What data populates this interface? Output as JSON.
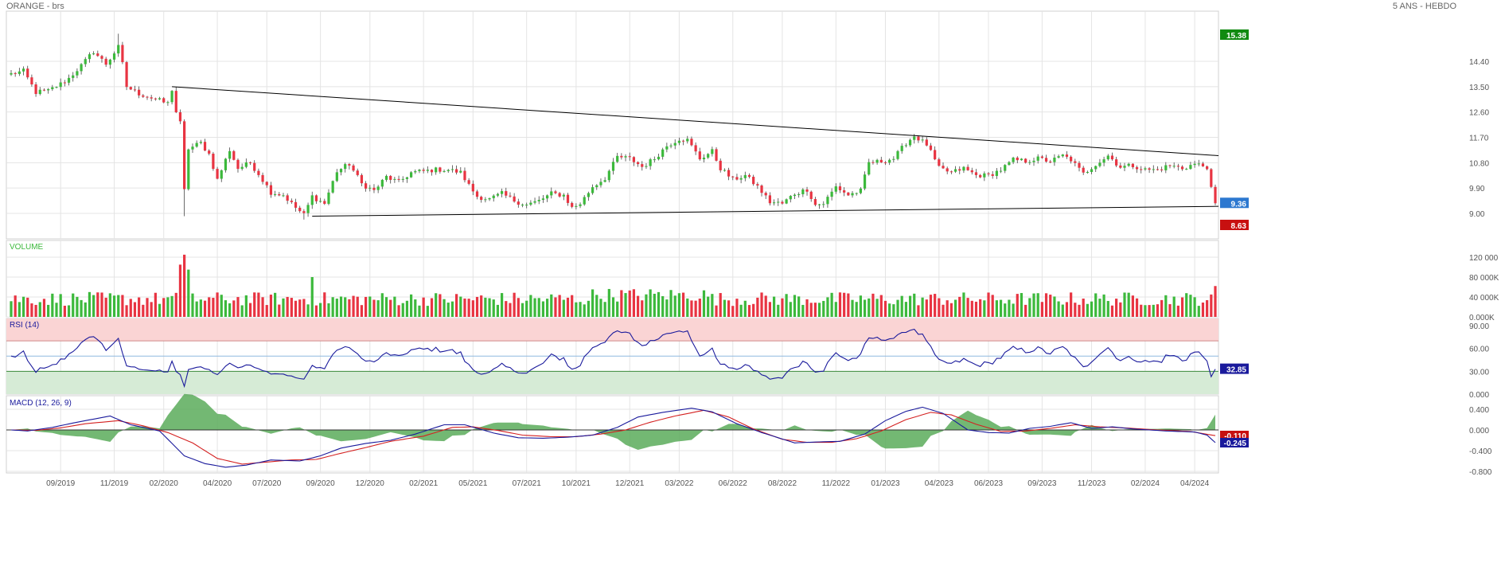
{
  "header": {
    "title": "ORANGE - brs",
    "period": "5 ANS - HEBDO"
  },
  "colors": {
    "up": "#3cb93c",
    "down": "#e83442",
    "grid": "#e4e4e4",
    "axis_text": "#555555",
    "trendline": "#000000",
    "rsi_line": "#1a1a9c",
    "rsi_overbought_fill": "#fad4d4",
    "rsi_oversold_fill": "#d6ebd6",
    "macd_line": "#1a1a9c",
    "signal_line": "#d42020",
    "histogram": "#5aab5a",
    "badge_high": "#118a11",
    "badge_low": "#c81010",
    "badge_last": "#2c78d0",
    "badge_rsi": "#1a1a9c",
    "badge_signal": "#c81010",
    "badge_macd": "#1a1a9c"
  },
  "chart_data": [
    {
      "type": "candlestick",
      "name": "price",
      "y_ticks": [
        "14.40",
        "13.50",
        "12.60",
        "11.70",
        "10.80",
        "9.90",
        "9.00"
      ],
      "y_range": [
        8.63,
        15.38
      ],
      "x_tick_labels": [
        "09/2019",
        "11/2019",
        "02/2020",
        "04/2020",
        "07/2020",
        "09/2020",
        "12/2020",
        "02/2021",
        "05/2021",
        "07/2021",
        "10/2021",
        "12/2021",
        "03/2022",
        "06/2022",
        "08/2022",
        "11/2022",
        "01/2023",
        "04/2023",
        "06/2023",
        "09/2023",
        "11/2023",
        "02/2024",
        "04/2024"
      ],
      "close_anchors": [
        [
          0,
          13.95
        ],
        [
          3,
          14.05
        ],
        [
          6,
          13.3
        ],
        [
          9,
          13.35
        ],
        [
          12,
          13.6
        ],
        [
          14,
          13.8
        ],
        [
          17,
          14.25
        ],
        [
          20,
          14.75
        ],
        [
          23,
          14.3
        ],
        [
          26,
          14.9
        ],
        [
          27,
          14.3
        ],
        [
          28,
          13.5
        ],
        [
          31,
          13.25
        ],
        [
          35,
          13.05
        ],
        [
          38,
          12.9
        ],
        [
          39,
          13.4
        ],
        [
          40,
          12.6
        ],
        [
          41,
          12.2
        ],
        [
          42,
          9.8
        ],
        [
          43,
          11.3
        ],
        [
          46,
          11.5
        ],
        [
          48,
          11.1
        ],
        [
          50,
          10.2
        ],
        [
          53,
          11.25
        ],
        [
          55,
          10.6
        ],
        [
          58,
          10.8
        ],
        [
          60,
          10.4
        ],
        [
          63,
          9.75
        ],
        [
          66,
          9.65
        ],
        [
          69,
          9.2
        ],
        [
          71,
          8.95
        ],
        [
          73,
          9.6
        ],
        [
          76,
          9.35
        ],
        [
          79,
          10.5
        ],
        [
          82,
          10.75
        ],
        [
          85,
          10.05
        ],
        [
          88,
          9.8
        ],
        [
          91,
          10.3
        ],
        [
          94,
          10.1
        ],
        [
          97,
          10.45
        ],
        [
          100,
          10.5
        ],
        [
          103,
          10.55
        ],
        [
          106,
          10.55
        ],
        [
          109,
          10.45
        ],
        [
          111,
          10.0
        ],
        [
          113,
          9.6
        ],
        [
          116,
          9.5
        ],
        [
          119,
          9.7
        ],
        [
          122,
          9.45
        ],
        [
          125,
          9.3
        ],
        [
          128,
          9.45
        ],
        [
          131,
          9.7
        ],
        [
          134,
          9.65
        ],
        [
          136,
          9.2
        ],
        [
          138,
          9.35
        ],
        [
          141,
          9.95
        ],
        [
          144,
          10.25
        ],
        [
          147,
          11.0
        ],
        [
          150,
          10.95
        ],
        [
          153,
          10.65
        ],
        [
          156,
          10.95
        ],
        [
          159,
          11.4
        ],
        [
          162,
          11.65
        ],
        [
          164,
          11.6
        ],
        [
          167,
          10.95
        ],
        [
          170,
          11.2
        ],
        [
          172,
          10.6
        ],
        [
          175,
          10.2
        ],
        [
          178,
          10.35
        ],
        [
          181,
          9.95
        ],
        [
          184,
          9.4
        ],
        [
          187,
          9.35
        ],
        [
          190,
          9.7
        ],
        [
          193,
          9.85
        ],
        [
          195,
          9.3
        ],
        [
          197,
          9.35
        ],
        [
          200,
          9.95
        ],
        [
          203,
          9.65
        ],
        [
          206,
          9.8
        ],
        [
          208,
          10.8
        ],
        [
          211,
          10.85
        ],
        [
          214,
          10.95
        ],
        [
          217,
          11.5
        ],
        [
          219,
          11.75
        ],
        [
          222,
          11.45
        ],
        [
          225,
          10.6
        ],
        [
          228,
          10.45
        ],
        [
          231,
          10.6
        ],
        [
          234,
          10.35
        ],
        [
          237,
          10.35
        ],
        [
          240,
          10.55
        ],
        [
          243,
          10.9
        ],
        [
          246,
          10.85
        ],
        [
          249,
          10.95
        ],
        [
          252,
          10.85
        ],
        [
          255,
          11.05
        ],
        [
          257,
          10.9
        ],
        [
          260,
          10.4
        ],
        [
          263,
          10.75
        ],
        [
          266,
          11.05
        ],
        [
          269,
          10.65
        ],
        [
          272,
          10.7
        ],
        [
          275,
          10.55
        ],
        [
          278,
          10.55
        ],
        [
          281,
          10.7
        ],
        [
          284,
          10.6
        ],
        [
          287,
          10.75
        ],
        [
          290,
          10.65
        ],
        [
          291,
          9.85
        ],
        [
          292,
          9.36
        ]
      ],
      "ohlc": [],
      "trendlines": [
        {
          "name": "resistance",
          "from": [
            39,
            13.5
          ],
          "to": [
            292,
            11.05
          ]
        },
        {
          "name": "support",
          "from": [
            73,
            8.9
          ],
          "to": [
            292,
            9.25
          ]
        }
      ],
      "badges": {
        "high": "15.38",
        "last": "9.36",
        "low": "8.63"
      }
    },
    {
      "type": "bar",
      "name": "volume",
      "label": "VOLUME",
      "y_ticks": [
        "120 000",
        "80 000K",
        "40 000K",
        "0.000K"
      ],
      "y_range": [
        0,
        120000
      ],
      "tall_bars": [
        [
          41,
          105000
        ],
        [
          42,
          125000
        ],
        [
          43,
          95000
        ],
        [
          73,
          80000
        ]
      ],
      "values": []
    },
    {
      "type": "line",
      "name": "rsi",
      "label": "RSI (14)",
      "y_ticks": [
        "90.00",
        "60.00",
        "30.00",
        "0.000"
      ],
      "overbought": 70,
      "oversold": 30,
      "reference": 50,
      "series": [
        {
          "values": []
        }
      ],
      "badge": "32.85"
    },
    {
      "type": "line",
      "name": "macd",
      "label": "MACD (12, 26, 9)",
      "y_ticks": [
        "0.400",
        "0.000",
        "-0.400",
        "-0.800"
      ],
      "y_range": [
        -0.88,
        0.52
      ],
      "macd_anchors": [
        [
          0,
          0.0
        ],
        [
          4,
          -0.02
        ],
        [
          10,
          0.05
        ],
        [
          16,
          0.15
        ],
        [
          24,
          0.27
        ],
        [
          29,
          0.1
        ],
        [
          36,
          -0.02
        ],
        [
          42,
          -0.5
        ],
        [
          47,
          -0.65
        ],
        [
          52,
          -0.72
        ],
        [
          57,
          -0.68
        ],
        [
          63,
          -0.58
        ],
        [
          70,
          -0.6
        ],
        [
          75,
          -0.5
        ],
        [
          80,
          -0.35
        ],
        [
          86,
          -0.26
        ],
        [
          92,
          -0.2
        ],
        [
          98,
          -0.08
        ],
        [
          105,
          0.1
        ],
        [
          110,
          0.1
        ],
        [
          117,
          -0.06
        ],
        [
          123,
          -0.15
        ],
        [
          129,
          -0.16
        ],
        [
          135,
          -0.14
        ],
        [
          141,
          -0.1
        ],
        [
          147,
          0.05
        ],
        [
          152,
          0.25
        ],
        [
          158,
          0.34
        ],
        [
          165,
          0.42
        ],
        [
          170,
          0.35
        ],
        [
          176,
          0.12
        ],
        [
          182,
          -0.05
        ],
        [
          190,
          -0.25
        ],
        [
          196,
          -0.23
        ],
        [
          201,
          -0.22
        ],
        [
          207,
          -0.08
        ],
        [
          212,
          0.18
        ],
        [
          217,
          0.36
        ],
        [
          221,
          0.44
        ],
        [
          226,
          0.32
        ],
        [
          232,
          0.0
        ],
        [
          237,
          -0.05
        ],
        [
          242,
          -0.06
        ],
        [
          247,
          0.03
        ],
        [
          252,
          0.07
        ],
        [
          257,
          0.14
        ],
        [
          262,
          0.03
        ],
        [
          267,
          0.06
        ],
        [
          272,
          0.02
        ],
        [
          280,
          -0.02
        ],
        [
          287,
          -0.04
        ],
        [
          290,
          -0.1
        ],
        [
          292,
          -0.245
        ]
      ],
      "signal_anchors": [
        [
          0,
          0.0
        ],
        [
          6,
          -0.01
        ],
        [
          12,
          0.04
        ],
        [
          18,
          0.12
        ],
        [
          26,
          0.18
        ],
        [
          32,
          0.08
        ],
        [
          38,
          -0.05
        ],
        [
          44,
          -0.25
        ],
        [
          50,
          -0.55
        ],
        [
          56,
          -0.66
        ],
        [
          62,
          -0.62
        ],
        [
          68,
          -0.58
        ],
        [
          74,
          -0.57
        ],
        [
          80,
          -0.45
        ],
        [
          86,
          -0.34
        ],
        [
          92,
          -0.22
        ],
        [
          100,
          -0.12
        ],
        [
          107,
          0.05
        ],
        [
          112,
          0.06
        ],
        [
          118,
          -0.01
        ],
        [
          124,
          -0.1
        ],
        [
          131,
          -0.13
        ],
        [
          137,
          -0.13
        ],
        [
          143,
          -0.08
        ],
        [
          149,
          0.0
        ],
        [
          155,
          0.15
        ],
        [
          161,
          0.27
        ],
        [
          168,
          0.38
        ],
        [
          174,
          0.25
        ],
        [
          180,
          0.02
        ],
        [
          187,
          -0.18
        ],
        [
          193,
          -0.24
        ],
        [
          199,
          -0.24
        ],
        [
          205,
          -0.17
        ],
        [
          211,
          -0.02
        ],
        [
          217,
          0.2
        ],
        [
          223,
          0.34
        ],
        [
          228,
          0.29
        ],
        [
          234,
          0.11
        ],
        [
          240,
          -0.03
        ],
        [
          246,
          -0.02
        ],
        [
          252,
          0.03
        ],
        [
          258,
          0.1
        ],
        [
          264,
          0.06
        ],
        [
          270,
          0.04
        ],
        [
          278,
          0.0
        ],
        [
          286,
          -0.03
        ],
        [
          292,
          -0.11
        ]
      ],
      "badges": {
        "signal": "-0.110",
        "macd": "-0.245"
      }
    }
  ]
}
